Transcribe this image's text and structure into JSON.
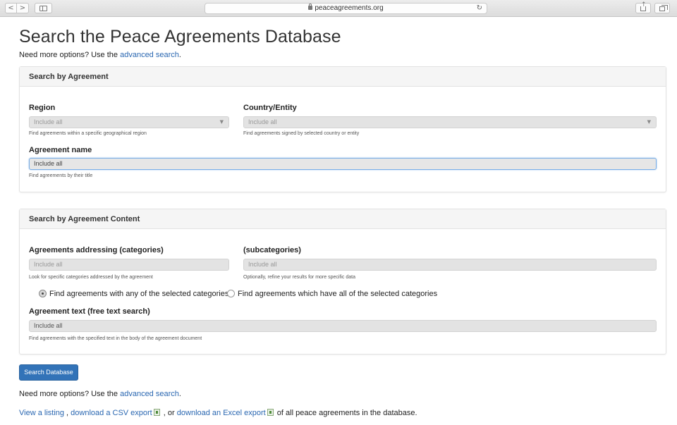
{
  "browser": {
    "url": "peaceagreements.org",
    "back_icon": "<",
    "forward_icon": ">"
  },
  "page": {
    "title": "Search the Peace Agreements Database",
    "intro_prefix": "Need more options? Use the ",
    "intro_link": "advanced search",
    "intro_suffix": "."
  },
  "agreement_panel": {
    "heading": "Search by Agreement",
    "region": {
      "label": "Region",
      "value": "Include all",
      "help": "Find agreements within a specific geographical region"
    },
    "country": {
      "label": "Country/Entity",
      "value": "Include all",
      "help": "Find agreements signed by selected country or entity"
    },
    "name": {
      "label": "Agreement name",
      "value": "Include all",
      "help": "Find agreements by their title"
    }
  },
  "content_panel": {
    "heading": "Search by Agreement Content",
    "categories": {
      "label": "Agreements addressing (categories)",
      "value": "Include all",
      "help": "Look for specific categories addressed by the agreement"
    },
    "subcategories": {
      "label": "(subcategories)",
      "value": "Include all",
      "help": "Optionally, refine your results for more specific data"
    },
    "radio_any": "Find agreements with any of the selected categories",
    "radio_all": "Find agreements which have all of the selected categories",
    "selected_radio": "any",
    "text_search": {
      "label": "Agreement text (free text search)",
      "value": "Include all",
      "help": "Find agreements with the specified text in the body of the agreement document"
    }
  },
  "search_button": "Search Database",
  "footer": {
    "more_prefix": "Need more options? Use the ",
    "more_link": "advanced search",
    "more_suffix": ".",
    "listing_link": "View a listing",
    "sep1": " , ",
    "csv_link": "download a CSV export",
    "sep2": " , or ",
    "excel_link": "download an Excel export",
    "tail": " of all peace agreements in the database."
  },
  "colors": {
    "link": "#2a67b1",
    "primary_button": "#3273b8",
    "focus_border": "#7aaee6"
  },
  "icons": [
    "chevron-left-icon",
    "chevron-right-icon",
    "sidebar-icon",
    "lock-icon",
    "reload-icon",
    "share-icon",
    "tabs-icon",
    "dropdown-caret-icon",
    "excel-file-icon"
  ]
}
